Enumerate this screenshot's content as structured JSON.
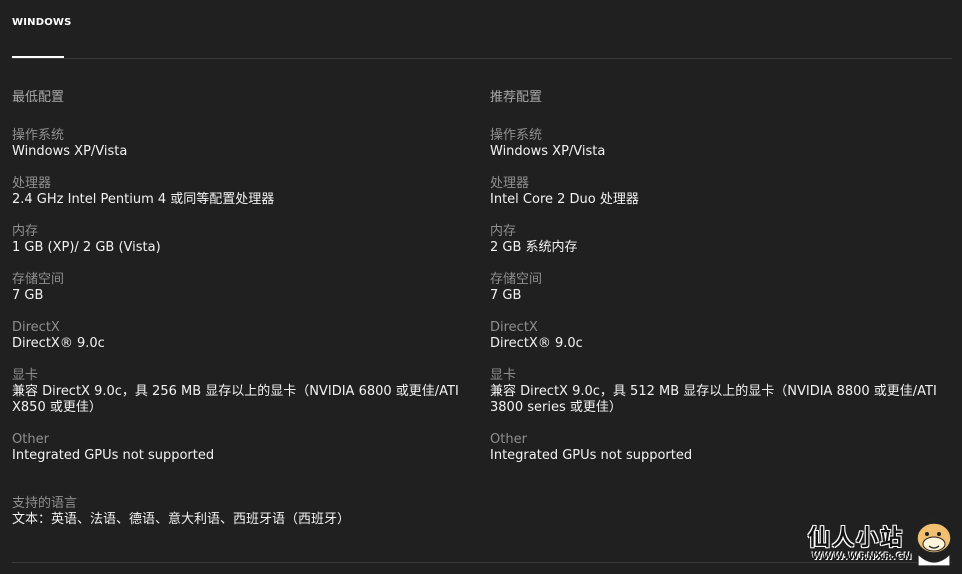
{
  "tabs": [
    {
      "label": "WINDOWS",
      "active": true
    }
  ],
  "minimum": {
    "heading": "最低配置",
    "specs": [
      {
        "label": "操作系统",
        "value": "Windows XP/Vista"
      },
      {
        "label": "处理器",
        "value": "2.4 GHz Intel Pentium 4 或同等配置处理器"
      },
      {
        "label": "内存",
        "value": "1 GB (XP)/ 2 GB (Vista)"
      },
      {
        "label": "存储空间",
        "value": "7 GB"
      },
      {
        "label": "DirectX",
        "value": "DirectX® 9.0c"
      },
      {
        "label": "显卡",
        "value": "兼容 DirectX 9.0c，具 256 MB 显存以上的显卡（NVIDIA 6800 或更佳/ATI X850 或更佳）"
      },
      {
        "label": "Other",
        "value": "Integrated GPUs not supported"
      }
    ]
  },
  "recommended": {
    "heading": "推荐配置",
    "specs": [
      {
        "label": "操作系统",
        "value": "Windows XP/Vista"
      },
      {
        "label": "处理器",
        "value": "Intel Core 2 Duo 处理器"
      },
      {
        "label": "内存",
        "value": "2 GB 系统内存"
      },
      {
        "label": "存储空间",
        "value": "7 GB"
      },
      {
        "label": "DirectX",
        "value": "DirectX® 9.0c"
      },
      {
        "label": "显卡",
        "value": "兼容 DirectX 9.0c，具 512 MB 显存以上的显卡（NVIDIA 8800 或更佳/ATI 3800 series 或更佳）"
      },
      {
        "label": "Other",
        "value": "Integrated GPUs not supported"
      }
    ]
  },
  "languages": {
    "label": "支持的语言",
    "value": "文本：英语、法语、德语、意大利语、西班牙语（西班牙）"
  },
  "watermark": {
    "title": "仙人小站",
    "url": "WWW.WRNXR.CN"
  },
  "colors": {
    "background": "#202020",
    "label": "#8f8f8f",
    "value": "#f2f2f2",
    "divider": "#3a3a3a"
  }
}
